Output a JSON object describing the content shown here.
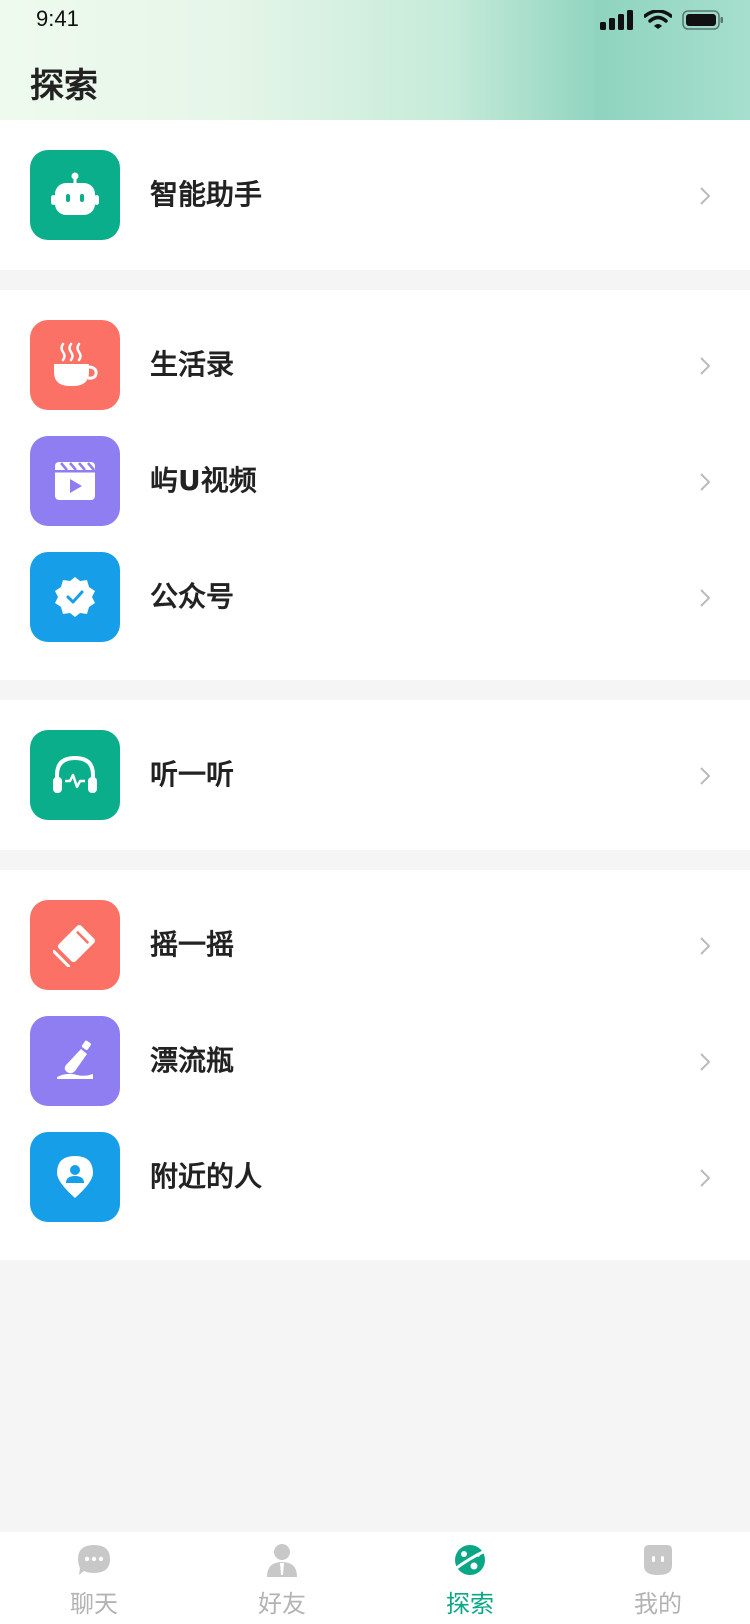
{
  "status_bar": {
    "time": "9:41"
  },
  "header": {
    "title": "探索"
  },
  "groups": [
    {
      "items": [
        {
          "label": "智能助手",
          "icon": "robot-icon",
          "color": "#0aae8a"
        }
      ]
    },
    {
      "items": [
        {
          "label": "生活录",
          "icon": "coffee-cup-icon",
          "color": "#fb7166"
        },
        {
          "label": "屿U视频",
          "icon": "video-clapper-icon",
          "color": "#8f7ef2"
        },
        {
          "label": "公众号",
          "icon": "verified-badge-icon",
          "color": "#169ee8"
        }
      ]
    },
    {
      "items": [
        {
          "label": "听一听",
          "icon": "headphones-icon",
          "color": "#0aae8a"
        }
      ]
    },
    {
      "items": [
        {
          "label": "摇一摇",
          "icon": "shake-phone-icon",
          "color": "#fb7166"
        },
        {
          "label": "漂流瓶",
          "icon": "drift-bottle-icon",
          "color": "#8f7ef2"
        },
        {
          "label": "附近的人",
          "icon": "location-person-icon",
          "color": "#169ee8"
        }
      ]
    }
  ],
  "tabbar": {
    "tabs": [
      {
        "label": "聊天",
        "icon": "chat-bubble-icon"
      },
      {
        "label": "好友",
        "icon": "friends-icon"
      },
      {
        "label": "探索",
        "icon": "explore-planet-icon"
      },
      {
        "label": "我的",
        "icon": "profile-face-icon"
      }
    ],
    "active": "探索",
    "active_color": "#0aa786",
    "inactive_color": "#b3b3b3"
  }
}
